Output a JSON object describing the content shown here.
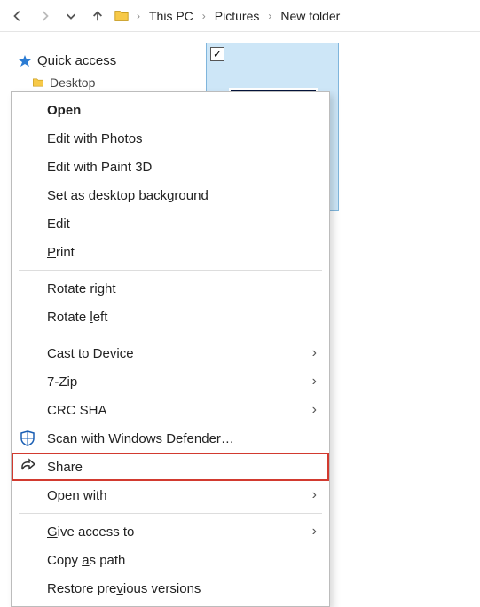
{
  "nav": {
    "back": "Back",
    "forward": "Forward",
    "recent": "Recent locations",
    "up": "Up"
  },
  "breadcrumb": {
    "root": "This PC",
    "mid": "Pictures",
    "leaf": "New folder"
  },
  "sidebar": {
    "quick_access": "Quick access",
    "desktop": "Desktop"
  },
  "thumbnail": {
    "checked": true
  },
  "menu": {
    "open": "Open",
    "edit_photos": "Edit with Photos",
    "edit_paint3d": "Edit with Paint 3D",
    "set_bg_pre": "Set as desktop ",
    "set_bg_key": "b",
    "set_bg_post": "ackground",
    "edit": "Edit",
    "print_key": "P",
    "print_post": "rint",
    "rotate_right_pre": "Rotate ri",
    "rotate_right_key": "g",
    "rotate_right_post": "ht",
    "rotate_left_pre": "Rotate ",
    "rotate_left_key": "l",
    "rotate_left_post": "eft",
    "cast": "Cast to Device",
    "seven_zip": "7-Zip",
    "crc_sha": "CRC SHA",
    "scan_defender": "Scan with Windows Defender…",
    "share": "Share",
    "open_with_pre": "Open wit",
    "open_with_key": "h",
    "give_access_pre": "",
    "give_access_key": "G",
    "give_access_post": "ive access to",
    "copy_path_pre": "Copy ",
    "copy_path_key": "a",
    "copy_path_post": "s path",
    "restore_prev_pre": "Restore pre",
    "restore_prev_key": "v",
    "restore_prev_post": "ious versions"
  }
}
